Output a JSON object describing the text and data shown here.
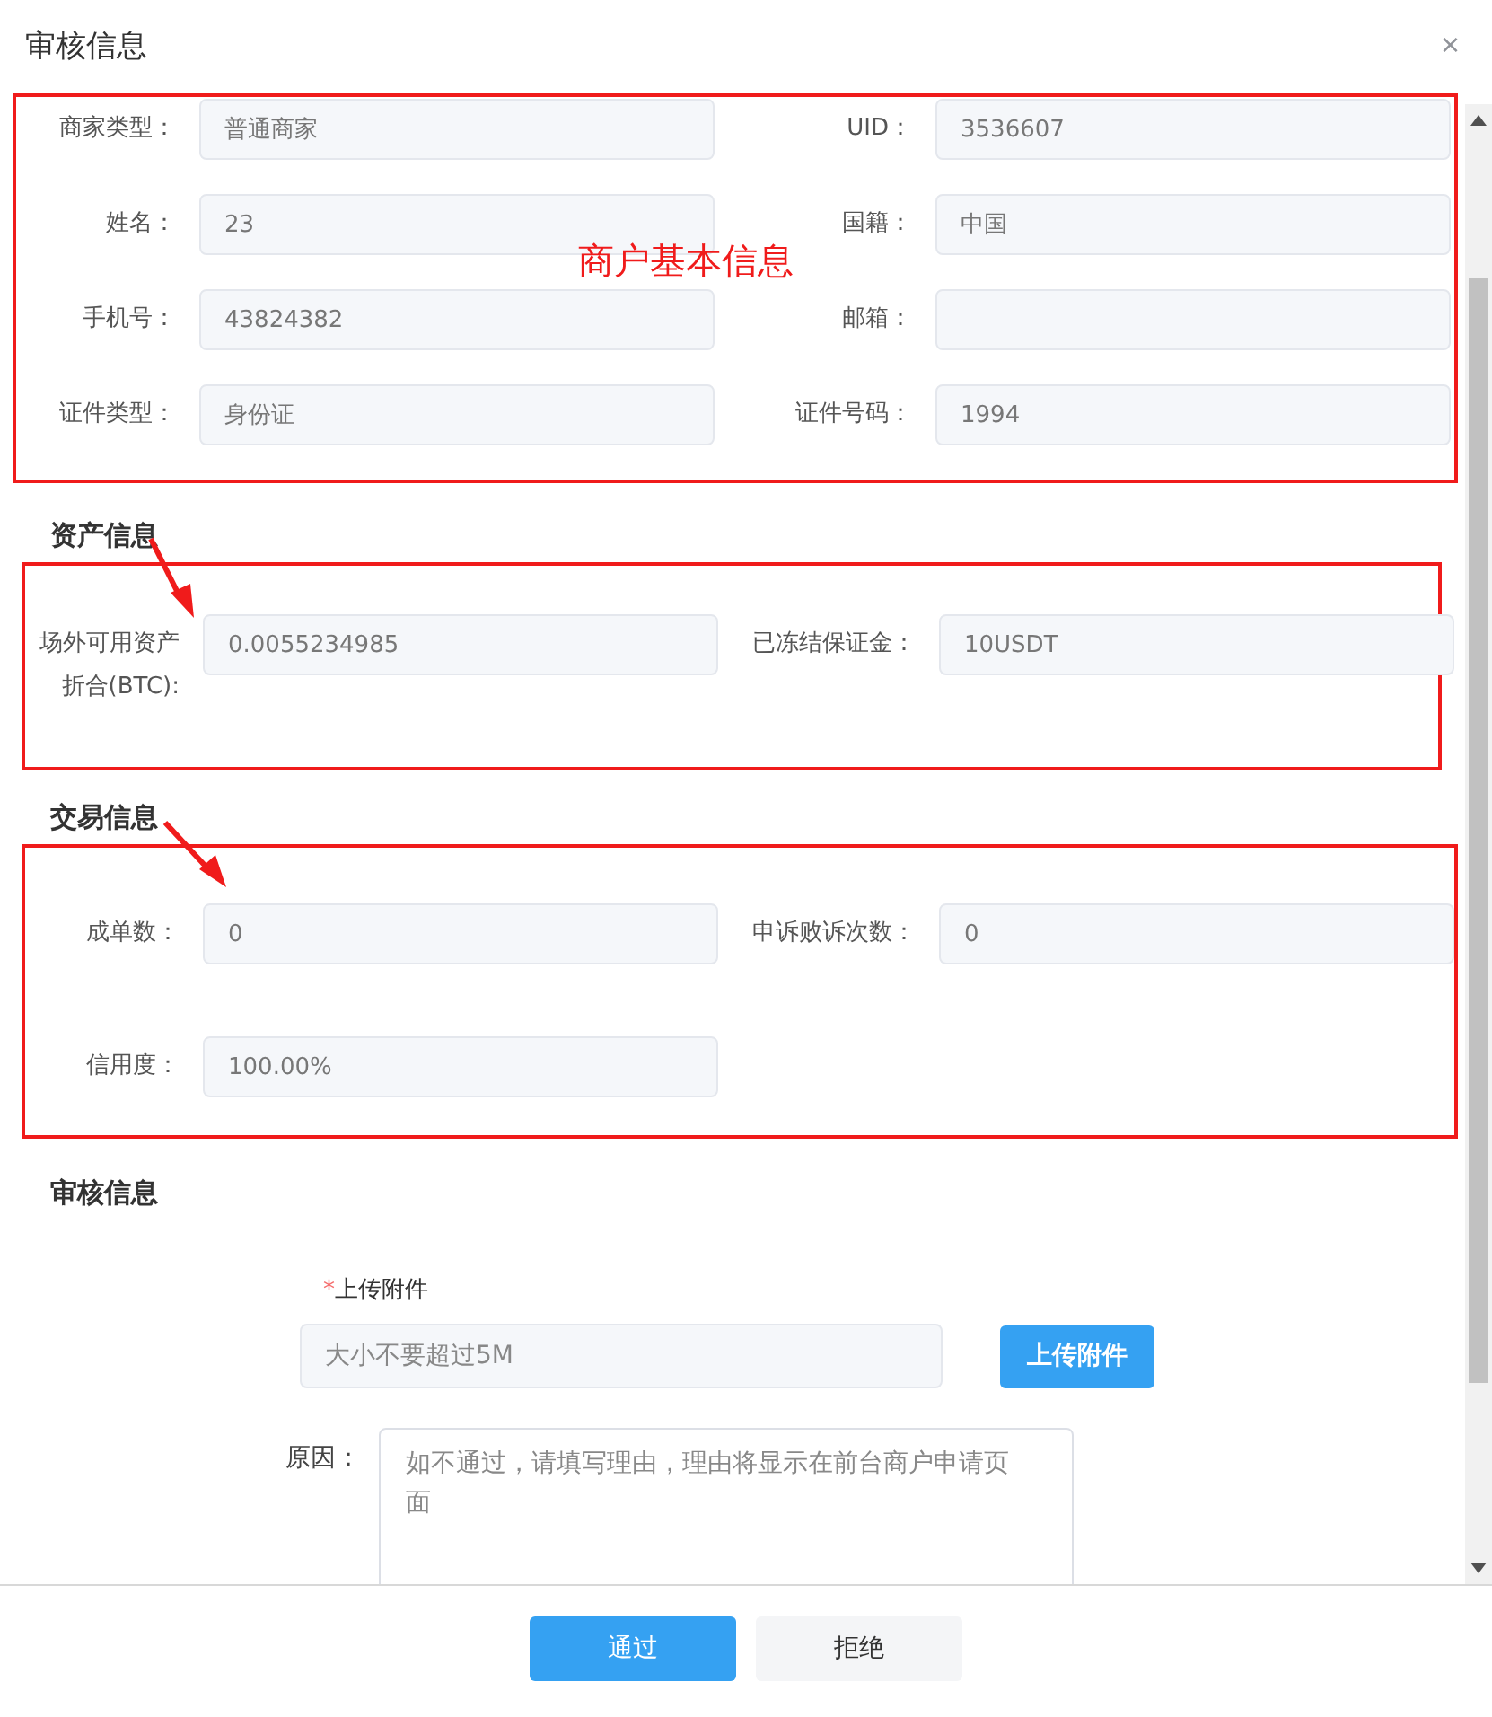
{
  "dialog": {
    "title": "审核信息",
    "close": "×"
  },
  "sections": [
    {
      "annotation": "商户基本信息",
      "fields": [
        {
          "label": "商家类型：",
          "value": "普通商家"
        },
        {
          "label": "UID：",
          "value": "3536607"
        },
        {
          "label": "姓名：",
          "value": "23"
        },
        {
          "label": "国籍：",
          "value": "中国"
        },
        {
          "label": "手机号：",
          "value": "43824382"
        },
        {
          "label": "邮箱："
        },
        {
          "label": "证件类型：",
          "value": "身份证"
        },
        {
          "label": "证件号码：",
          "value": "1994"
        }
      ]
    },
    {
      "heading": "资产信息",
      "fields": [
        {
          "label": "场外可用资产折合(BTC):",
          "value": "0.0055234985"
        },
        {
          "label": "已冻结保证金：",
          "value": "10USDT"
        }
      ]
    },
    {
      "heading": "交易信息",
      "fields": [
        {
          "label": "成单数：",
          "value": "0"
        },
        {
          "label": "申诉败诉次数：",
          "value": "0"
        },
        {
          "label": "信用度：",
          "value": "100.00%"
        }
      ]
    }
  ],
  "review": {
    "heading": "审核信息",
    "upload": {
      "required_mark": "*",
      "label": "上传附件",
      "placeholder": "大小不要超过5M",
      "button": "上传附件"
    },
    "reason": {
      "label": "原因：",
      "placeholder": "如不通过，请填写理由，理由将显示在前台商户申请页面"
    }
  },
  "footer_buttons": [
    {
      "label": "通过",
      "kind": "primary"
    },
    {
      "label": "拒绝",
      "kind": "default"
    }
  ]
}
